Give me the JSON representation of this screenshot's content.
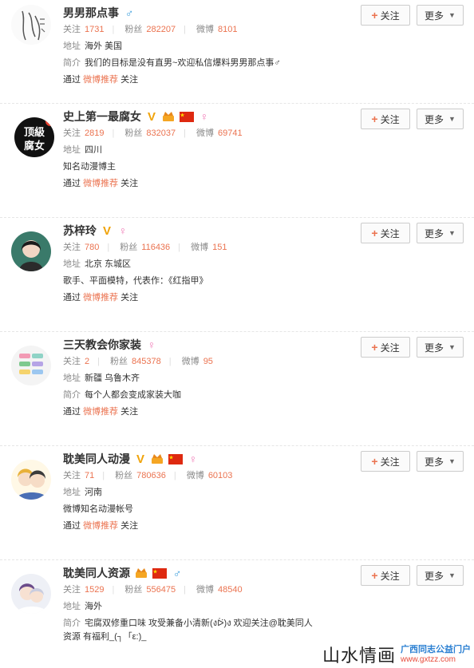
{
  "actions": {
    "follow_label": "关注",
    "more_label": "更多"
  },
  "labels": {
    "following": "关注",
    "fans": "粉丝",
    "weibo": "微博",
    "location": "地址",
    "intro": "简介",
    "via": "通过",
    "via_suffix": "关注"
  },
  "cards": [
    {
      "name": "男男那点事",
      "badges": [
        "gender-male"
      ],
      "following": "1731",
      "fans": "282207",
      "weibo": "8101",
      "location": "海外 美国",
      "intro_label": "简介",
      "intro": "我们的目标是没有直男~欢迎私信爆料男男那点事♂",
      "via_link": "微博推荐"
    },
    {
      "name": "史上第一最腐女",
      "badges": [
        "v-icon",
        "crown-icon",
        "flag-icon",
        "gender-female"
      ],
      "following": "2819",
      "fans": "832037",
      "weibo": "69741",
      "location": "四川",
      "intro_label": "",
      "intro": "知名动漫博主",
      "via_link": "微博推荐"
    },
    {
      "name": "苏梓玲",
      "badges": [
        "v-icon",
        "gender-female"
      ],
      "following": "780",
      "fans": "116436",
      "weibo": "151",
      "location": "北京 东城区",
      "intro_label": "",
      "intro": "歌手、平面模特，代表作：《红指甲》",
      "via_link": "微博推荐"
    },
    {
      "name": "三天教会你家装",
      "badges": [
        "gender-female"
      ],
      "following": "2",
      "fans": "845378",
      "weibo": "95",
      "location": "新疆 乌鲁木齐",
      "intro_label": "简介",
      "intro": "每个人都会变成家装大咖",
      "via_link": "微博推荐"
    },
    {
      "name": "耽美同人动漫",
      "badges": [
        "v-icon",
        "crown-icon",
        "flag-icon",
        "gender-female"
      ],
      "following": "71",
      "fans": "780636",
      "weibo": "60103",
      "location": "河南",
      "intro_label": "",
      "intro": "微博知名动漫帐号",
      "via_link": "微博推荐"
    },
    {
      "name": "耽美同人资源",
      "badges": [
        "crown-icon",
        "flag-icon",
        "gender-male"
      ],
      "following": "1529",
      "fans": "556475",
      "weibo": "48540",
      "location": "海外",
      "intro_label": "简介",
      "intro": "宅腐双修重口味 攻受兼备小清新(งᐖ)ง 欢迎关注@耽美同人",
      "intro2": "资源 有福利_(┐「ε:)_",
      "via_link": ""
    }
  ],
  "avatars": [
    "logo-text-avatar",
    "顶級腐女",
    "girl-portrait",
    "color-blocks",
    "anime-boys",
    "anime-couple"
  ],
  "watermark": {
    "title": "山水情画",
    "sub1": "广西同志公益门户",
    "sub2": "www.gxtzz.com"
  },
  "colors": {
    "accent": "#eb7350",
    "v_badge": "#f0a30a",
    "male": "#3e9fdc",
    "female": "#f076b4"
  }
}
